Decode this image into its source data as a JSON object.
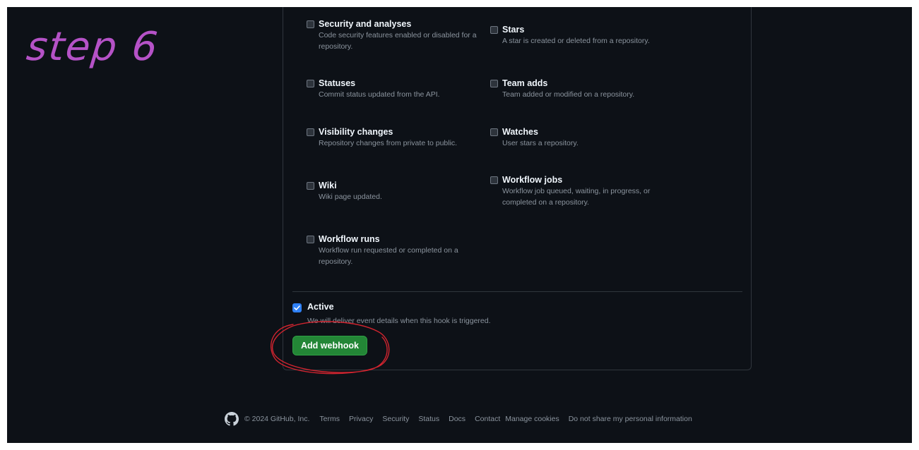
{
  "annotation": {
    "text": "step 6"
  },
  "events": [
    {
      "title": "Security and analyses",
      "desc": "Code security features enabled or disabled for a repository."
    },
    {
      "title": "Stars",
      "desc": "A star is created or deleted from a repository."
    },
    {
      "title": "Statuses",
      "desc": "Commit status updated from the API."
    },
    {
      "title": "Team adds",
      "desc": "Team added or modified on a repository."
    },
    {
      "title": "Visibility changes",
      "desc": "Repository changes from private to public."
    },
    {
      "title": "Watches",
      "desc": "User stars a repository."
    },
    {
      "title": "Wiki",
      "desc": "Wiki page updated."
    },
    {
      "title": "Workflow jobs",
      "desc": "Workflow job queued, waiting, in progress, or completed on a repository."
    },
    {
      "title": "Workflow runs",
      "desc": "Workflow run requested or completed on a repository."
    }
  ],
  "active": {
    "checked": true,
    "label": "Active",
    "desc": "We will deliver event details when this hook is triggered."
  },
  "submit": {
    "label": "Add webhook"
  },
  "footer": {
    "copyright": "© 2024 GitHub, Inc.",
    "links": [
      "Terms",
      "Privacy",
      "Security",
      "Status",
      "Docs",
      "Contact",
      "Manage cookies",
      "Do not share my personal information"
    ]
  },
  "colors": {
    "background": "#0d1117",
    "annotation": "#b552c7",
    "button": "#238636",
    "checkbox_active": "#2f81f7",
    "circle": "#d1242f"
  }
}
